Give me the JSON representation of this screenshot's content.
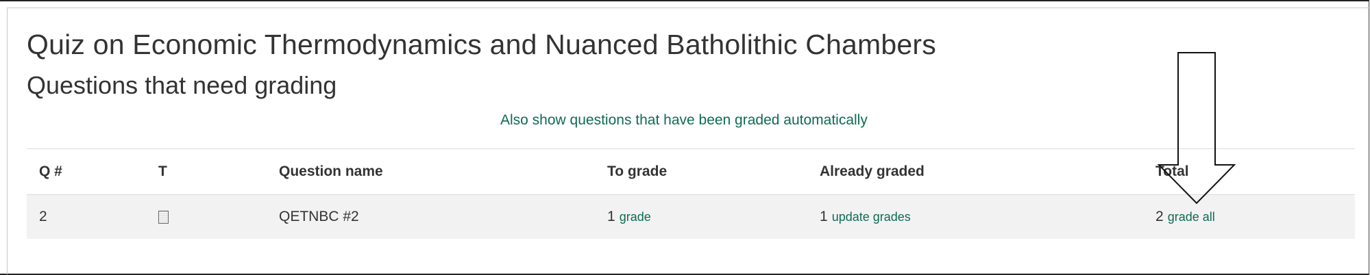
{
  "page": {
    "title": "Quiz on Economic Thermodynamics and Nuanced Batholithic Chambers",
    "subtitle": "Questions that need grading",
    "show_auto_link": "Also show questions that have been graded automatically"
  },
  "table": {
    "headers": {
      "q_num": "Q #",
      "type": "T",
      "question_name": "Question name",
      "to_grade": "To grade",
      "already_graded": "Already graded",
      "total": "Total"
    },
    "rows": [
      {
        "q_num": "2",
        "type_icon": "essay-question-icon",
        "question_name": "QETNBC #2",
        "to_grade_count": "1",
        "to_grade_link": "grade",
        "already_graded_count": "1",
        "already_graded_link": "update grades",
        "total_count": "2",
        "total_link": "grade all"
      }
    ]
  },
  "colors": {
    "link": "#0f6b54",
    "row_background": "#f2f2f2",
    "text": "#333333"
  },
  "annotation": {
    "icon": "down-arrow-annotation"
  }
}
